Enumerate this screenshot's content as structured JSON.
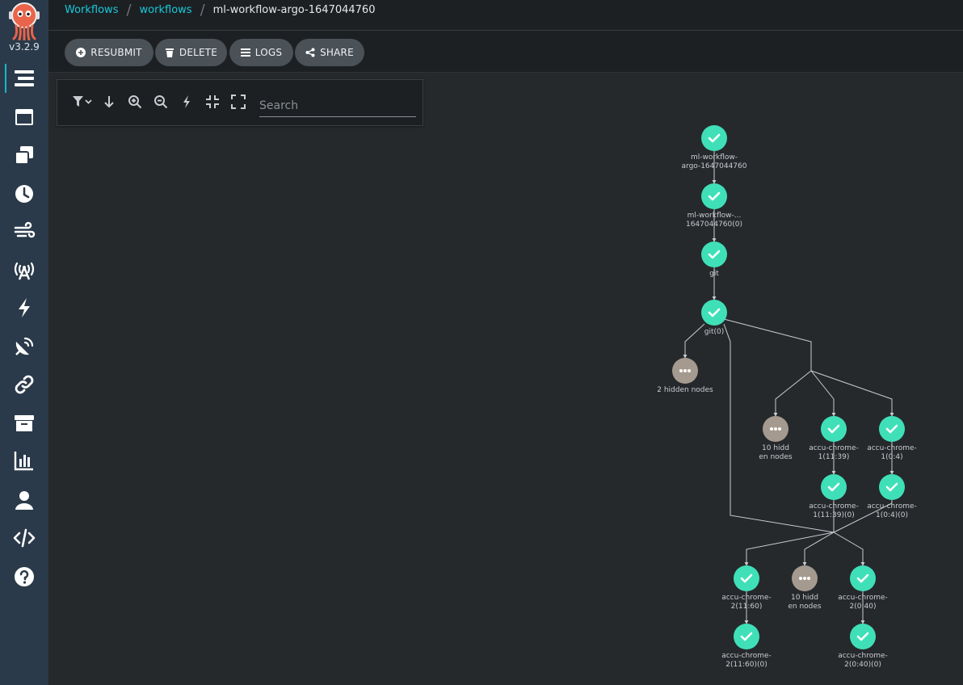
{
  "app": {
    "version": "v3.2.9"
  },
  "breadcrumbs": [
    {
      "label": "Workflows"
    },
    {
      "label": "workflows"
    },
    {
      "label": "ml-workflow-argo-1647044760"
    }
  ],
  "sidebar": {
    "items": [
      {
        "icon": "timeline-icon",
        "active": true
      },
      {
        "icon": "window-icon"
      },
      {
        "icon": "clone-icon"
      },
      {
        "icon": "clock-icon"
      },
      {
        "icon": "stream-icon"
      },
      {
        "icon": "broadcast-tower-icon"
      },
      {
        "icon": "bolt-icon"
      },
      {
        "icon": "satellite-dish-icon"
      },
      {
        "icon": "link-icon"
      },
      {
        "icon": "archive-icon"
      },
      {
        "icon": "chart-bar-icon"
      },
      {
        "icon": "user-icon"
      },
      {
        "icon": "code-icon"
      },
      {
        "icon": "question-circle-icon"
      }
    ]
  },
  "actions": {
    "resubmit": "RESUBMIT",
    "delete": "DELETE",
    "logs": "LOGS",
    "share": "SHARE"
  },
  "graph_toolbar": {
    "search_placeholder": "Search"
  },
  "colors": {
    "succeeded": "#3fe0b8",
    "hidden": "#a59a8f",
    "link": "#18c8da",
    "edge": "#c9cdd1"
  },
  "graph": {
    "nodes": [
      {
        "id": "root",
        "status": "succeeded",
        "label": [
          "ml-workflow-",
          "argo-1647044760"
        ]
      },
      {
        "id": "retry0",
        "status": "succeeded",
        "label": [
          "ml-workflow-...",
          "1647044760(0)"
        ]
      },
      {
        "id": "git",
        "status": "succeeded",
        "label": [
          "git"
        ]
      },
      {
        "id": "git0",
        "status": "succeeded",
        "label": [
          "git(0)"
        ]
      },
      {
        "id": "hidden2",
        "status": "hidden",
        "label": [
          "2 hidden nodes"
        ]
      },
      {
        "id": "hidden10a",
        "status": "hidden",
        "label": [
          "10 hidd",
          "en nodes"
        ]
      },
      {
        "id": "c1a",
        "status": "succeeded",
        "label": [
          "accu-chrome-",
          "1(11:39)"
        ]
      },
      {
        "id": "c1b",
        "status": "succeeded",
        "label": [
          "accu-chrome-",
          "1(0:4)"
        ]
      },
      {
        "id": "c1a0",
        "status": "succeeded",
        "label": [
          "accu-chrome-",
          "1(11:39)(0)"
        ]
      },
      {
        "id": "c1b0",
        "status": "succeeded",
        "label": [
          "accu-chrome-",
          "1(0:4)(0)"
        ]
      },
      {
        "id": "c2a",
        "status": "succeeded",
        "label": [
          "accu-chrome-",
          "2(11:60)"
        ]
      },
      {
        "id": "hidden10b",
        "status": "hidden",
        "label": [
          "10 hidd",
          "en nodes"
        ]
      },
      {
        "id": "c2b",
        "status": "succeeded",
        "label": [
          "accu-chrome-",
          "2(0:40)"
        ]
      },
      {
        "id": "c2a0",
        "status": "succeeded",
        "label": [
          "accu-chrome-",
          "2(11:60)(0)"
        ]
      },
      {
        "id": "c2b0",
        "status": "succeeded",
        "label": [
          "accu-chrome-",
          "2(0:40)(0)"
        ]
      }
    ],
    "edges": [
      [
        "root",
        "retry0"
      ],
      [
        "retry0",
        "git"
      ],
      [
        "git",
        "git0"
      ],
      [
        "git0",
        "hidden2"
      ],
      [
        "git0",
        "fork1"
      ],
      [
        "fork1",
        "hidden10a"
      ],
      [
        "fork1",
        "c1a"
      ],
      [
        "fork1",
        "c1b"
      ],
      [
        "c1a",
        "c1a0"
      ],
      [
        "c1b",
        "c1b0"
      ],
      [
        "git0",
        "join1"
      ],
      [
        "c1a0",
        "join1"
      ],
      [
        "c1b0",
        "join1"
      ],
      [
        "join1",
        "c2a"
      ],
      [
        "join1",
        "hidden10b"
      ],
      [
        "join1",
        "c2b"
      ],
      [
        "c2a",
        "c2a0"
      ],
      [
        "c2b",
        "c2b0"
      ]
    ]
  }
}
